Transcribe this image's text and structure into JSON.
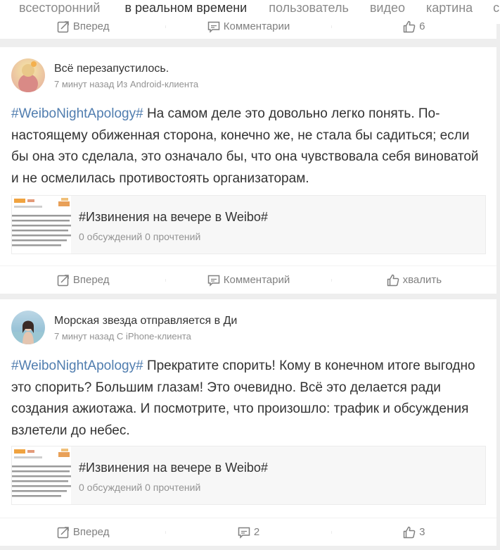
{
  "tabs": [
    {
      "label": "всесторонний",
      "active": false
    },
    {
      "label": "в реальном времени",
      "active": true
    },
    {
      "label": "пользователь",
      "active": false
    },
    {
      "label": "видео",
      "active": false
    },
    {
      "label": "картина",
      "active": false
    },
    {
      "label": "со",
      "active": false
    }
  ],
  "prev_actions": {
    "forward": "Вперед",
    "comment": "Комментарии",
    "like": "6"
  },
  "posts": [
    {
      "username": "Всё перезапустилось.",
      "meta": "7 минут назад Из Android-клиента",
      "hashtag": "#WeiboNightApology#",
      "text": " На самом деле это довольно легко понять. По-настоящему обиженная сторона, конечно же, не стала бы садиться; если бы она это сделала, это означало бы, что она чувствовала себя виноватой и не осмелилась противостоять организаторам.",
      "topic_title": "#Извинения на вечере в Weibo#",
      "topic_stats": "0 обсуждений 0 прочтений",
      "actions": {
        "forward": "Вперед",
        "comment": "Комментарий",
        "like": "хвалить"
      }
    },
    {
      "username": "Морская звезда отправляется в Ди",
      "meta": "7 минут назад С iPhone-клиента",
      "hashtag": "#WeiboNightApology#",
      "text": " Прекратите спорить! Кому в конечном итоге выгодно это спорить? Большим глазам! Это очевидно. Всё это делается ради создания ажиотажа. И посмотрите, что произошло: трафик и обсуждения взлетели до небес.",
      "topic_title": "#Извинения на вечере в Weibo#",
      "topic_stats": "0 обсуждений 0 прочтений",
      "actions": {
        "forward": "Вперед",
        "comment": "2",
        "like": "3"
      }
    }
  ],
  "colors": {
    "accent": "#ff8200",
    "link": "#507daf",
    "muted": "#939393"
  }
}
